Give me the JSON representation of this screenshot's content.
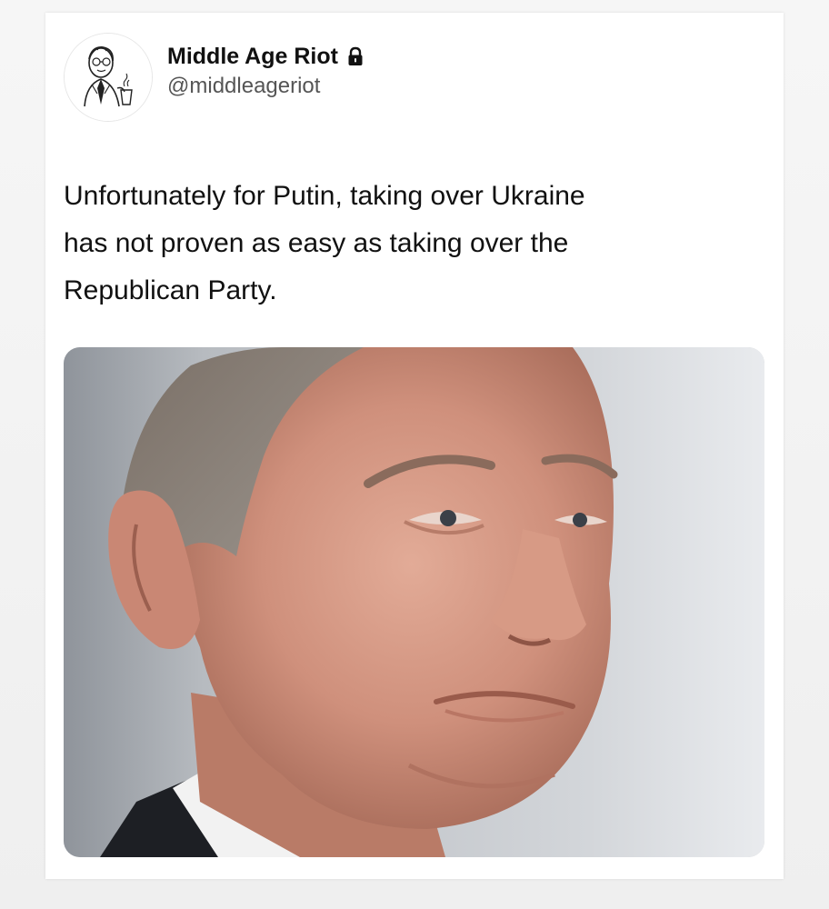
{
  "tweet": {
    "author": {
      "display_name": "Middle Age Riot",
      "handle": "@middleageriot",
      "avatar_icon": "sketched-man-avatar-icon",
      "protected_icon": "lock-icon"
    },
    "text": "Unfortunately for Putin, taking over Ukraine\nhas not proven as easy as taking over the\nRepublican Party.",
    "media": {
      "type": "photo",
      "subject": "close-up portrait of a man with pursed lips"
    }
  },
  "colors": {
    "page_background": "#f4f4f4",
    "card_background": "#ffffff",
    "text_primary": "#111111",
    "text_secondary": "#555555"
  }
}
